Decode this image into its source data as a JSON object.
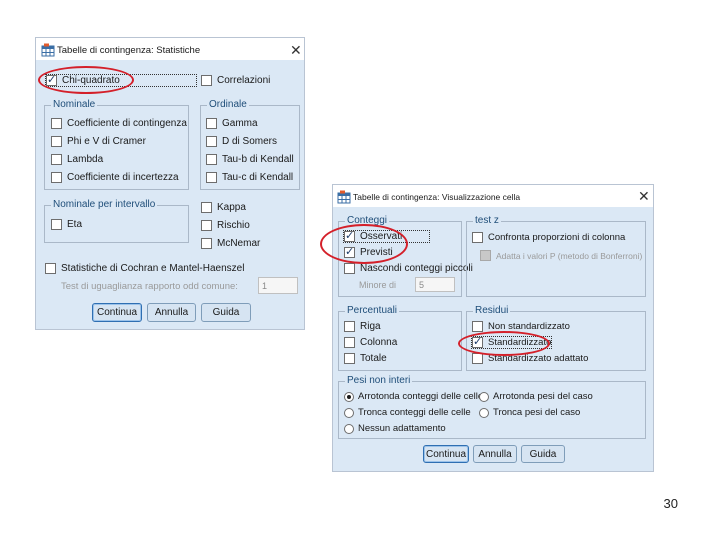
{
  "dialog1": {
    "title": "Tabelle di contingenza: Statistiche",
    "chi_quadrato": {
      "label": "Chi-quadrato",
      "checked": true
    },
    "correlazioni": {
      "label": "Correlazioni"
    },
    "nominale": {
      "legend": "Nominale",
      "items": [
        "Coefficiente di contingenza",
        "Phi e V di Cramer",
        "Lambda",
        "Coefficiente di incertezza"
      ]
    },
    "ordinale": {
      "legend": "Ordinale",
      "items": [
        "Gamma",
        "D di Somers",
        "Tau-b di Kendall",
        "Tau-c di Kendall"
      ]
    },
    "nominale_intervallo": {
      "legend": "Nominale per intervallo",
      "items": [
        "Eta"
      ]
    },
    "extra": [
      "Kappa",
      "Rischio",
      "McNemar"
    ],
    "cochran": {
      "label": "Statistiche di Cochran e Mantel-Haenszel"
    },
    "odd_test": {
      "label": "Test di uguaglianza rapporto odd comune:",
      "value": "1"
    },
    "buttons": {
      "continua": "Continua",
      "annulla": "Annulla",
      "guida": "Guida"
    }
  },
  "dialog2": {
    "title": "Tabelle di contingenza: Visualizzazione cella",
    "conteggi": {
      "legend": "Conteggi",
      "osservati": "Osservati",
      "previsti": "Previsti",
      "nascondi": "Nascondi conteggi piccoli",
      "minore_label": "Minore di",
      "minore_value": "5"
    },
    "test_z": {
      "legend": "test z",
      "confronta": "Confronta proporzioni di colonna",
      "adatta": "Adatta i valori P (metodo di Bonferroni)"
    },
    "percentuali": {
      "legend": "Percentuali",
      "items": [
        "Riga",
        "Colonna",
        "Totale"
      ]
    },
    "residui": {
      "legend": "Residui",
      "items": [
        "Non standardizzato",
        "Standardizzato",
        "Standardizzato adattato"
      ],
      "checked_index": 1
    },
    "pesi": {
      "legend": "Pesi non interi",
      "options": [
        "Arrotonda conteggi delle celle",
        "Arrotonda pesi del caso",
        "Tronca conteggi delle celle",
        "Tronca pesi del caso",
        "Nessun adattamento"
      ],
      "selected": "Arrotonda conteggi delle celle"
    },
    "buttons": {
      "continua": "Continua",
      "annulla": "Annulla",
      "guida": "Guida"
    }
  },
  "page_number": "30",
  "colors": {
    "annotation_ring": "#d4202a",
    "dialog_body": "#dbe8f5",
    "legend_text": "#1f4e79"
  }
}
